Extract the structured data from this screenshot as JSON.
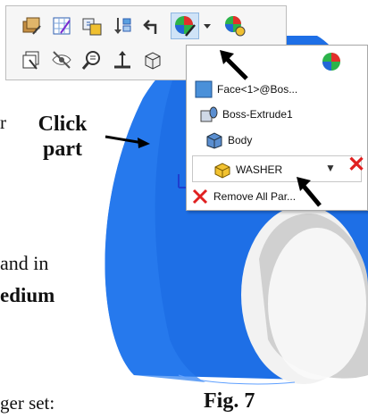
{
  "toolbar": {
    "row1": [
      "edit-appearance-icon",
      "sketch-grid-icon",
      "view-palette-icon",
      "sort-icon",
      "previous-view-icon",
      "appearance-sphere-icon",
      "dropdown-arrow-icon",
      "apply-scene-icon"
    ],
    "row2": [
      "section-view-icon",
      "hide-show-icon",
      "zoom-to-fit-icon",
      "normal-to-icon",
      "view-orientation-icon"
    ]
  },
  "menu": {
    "items": [
      {
        "label": "Face<1>@Bos...",
        "icon": "face-icon"
      },
      {
        "label": "Boss-Extrude1",
        "icon": "feature-icon"
      },
      {
        "label": "Body",
        "icon": "body-icon"
      },
      {
        "label": "WASHER",
        "icon": "part-icon"
      },
      {
        "label": "Remove All Par...",
        "icon": "remove-icon"
      }
    ],
    "combo_dropdown": "▼",
    "combo_remove": "✕"
  },
  "annotations": {
    "click_line1": "Click",
    "click_line2": "part",
    "fig_label": "Fig. 7",
    "side_text_1": "r",
    "side_text_2": "and in",
    "side_text_3": "edium",
    "side_text_4": "ger set:"
  },
  "colors": {
    "part_blue": "#1e6fe6",
    "hole_gray": "#d0d0d0",
    "red_x": "#e02020"
  }
}
